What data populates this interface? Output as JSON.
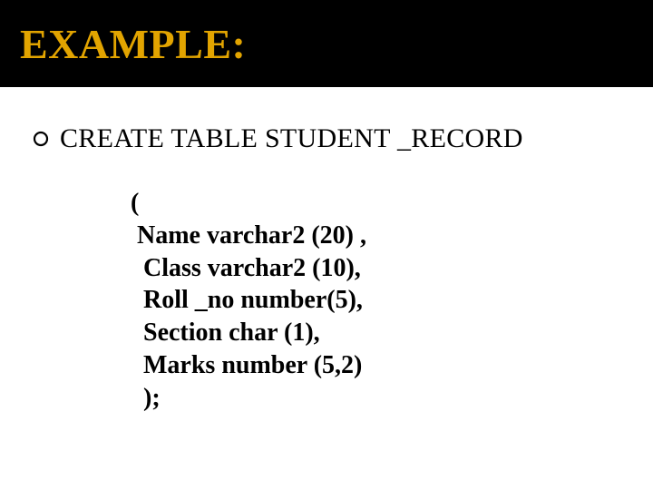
{
  "title": "EXAMPLE:",
  "bullet": "CREATE TABLE STUDENT _RECORD",
  "code_lines": [
    "(",
    " Name varchar2 (20) ,",
    "  Class varchar2 (10),",
    "  Roll _no number(5),",
    "  Section char (1),",
    "  Marks number (5,2)",
    "  );"
  ]
}
